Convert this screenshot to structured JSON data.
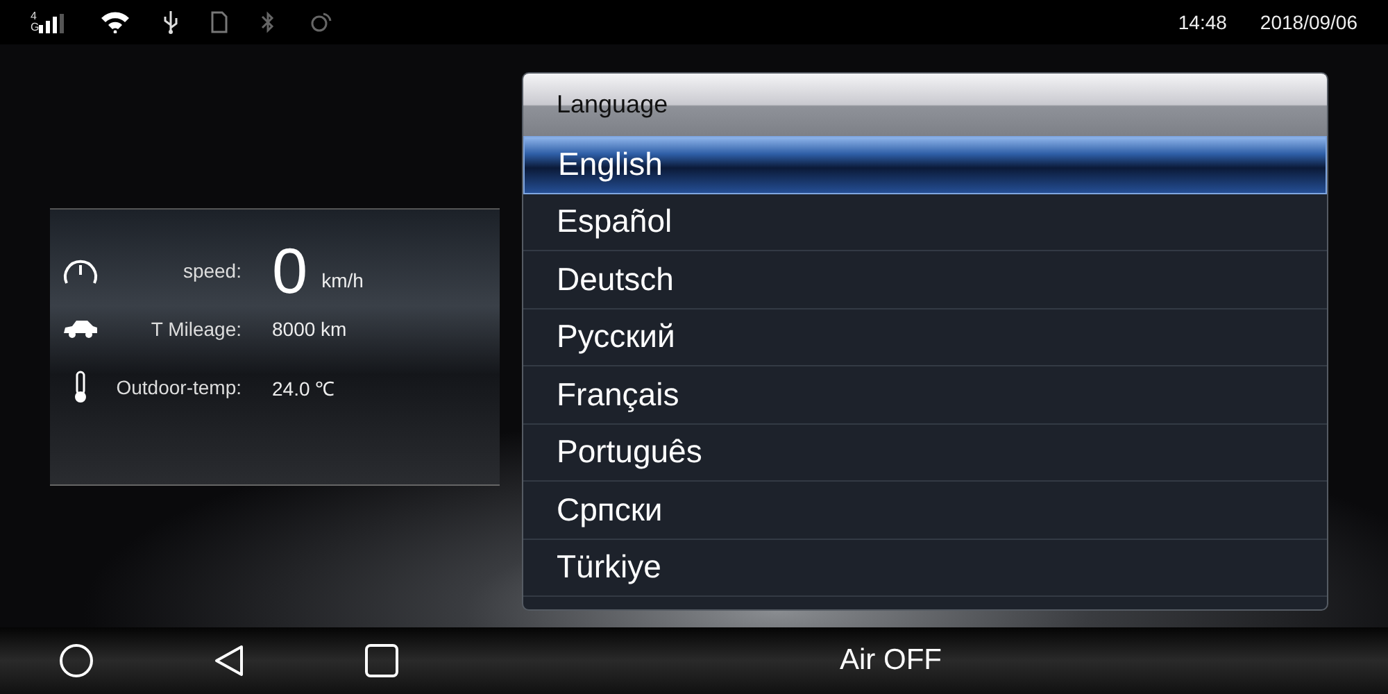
{
  "status_bar": {
    "network": "4G",
    "time": "14:48",
    "date": "2018/09/06"
  },
  "dashboard": {
    "rows": [
      {
        "kind": "speed",
        "label": "speed:",
        "value": "0",
        "unit": "km/h"
      },
      {
        "kind": "mileage",
        "label": "T Mileage:",
        "value": "8000 km"
      },
      {
        "kind": "temp",
        "label": "Outdoor-temp:",
        "value": "24.0 ℃"
      }
    ]
  },
  "dialog": {
    "title": "Language",
    "items": [
      {
        "label": "English",
        "selected": true
      },
      {
        "label": "Español",
        "selected": false
      },
      {
        "label": "Deutsch",
        "selected": false
      },
      {
        "label": "Русский",
        "selected": false
      },
      {
        "label": "Français",
        "selected": false
      },
      {
        "label": "Português",
        "selected": false
      },
      {
        "label": "Српски",
        "selected": false
      },
      {
        "label": "Türkiye",
        "selected": false
      }
    ]
  },
  "nav_bar": {
    "air": "Air OFF"
  }
}
